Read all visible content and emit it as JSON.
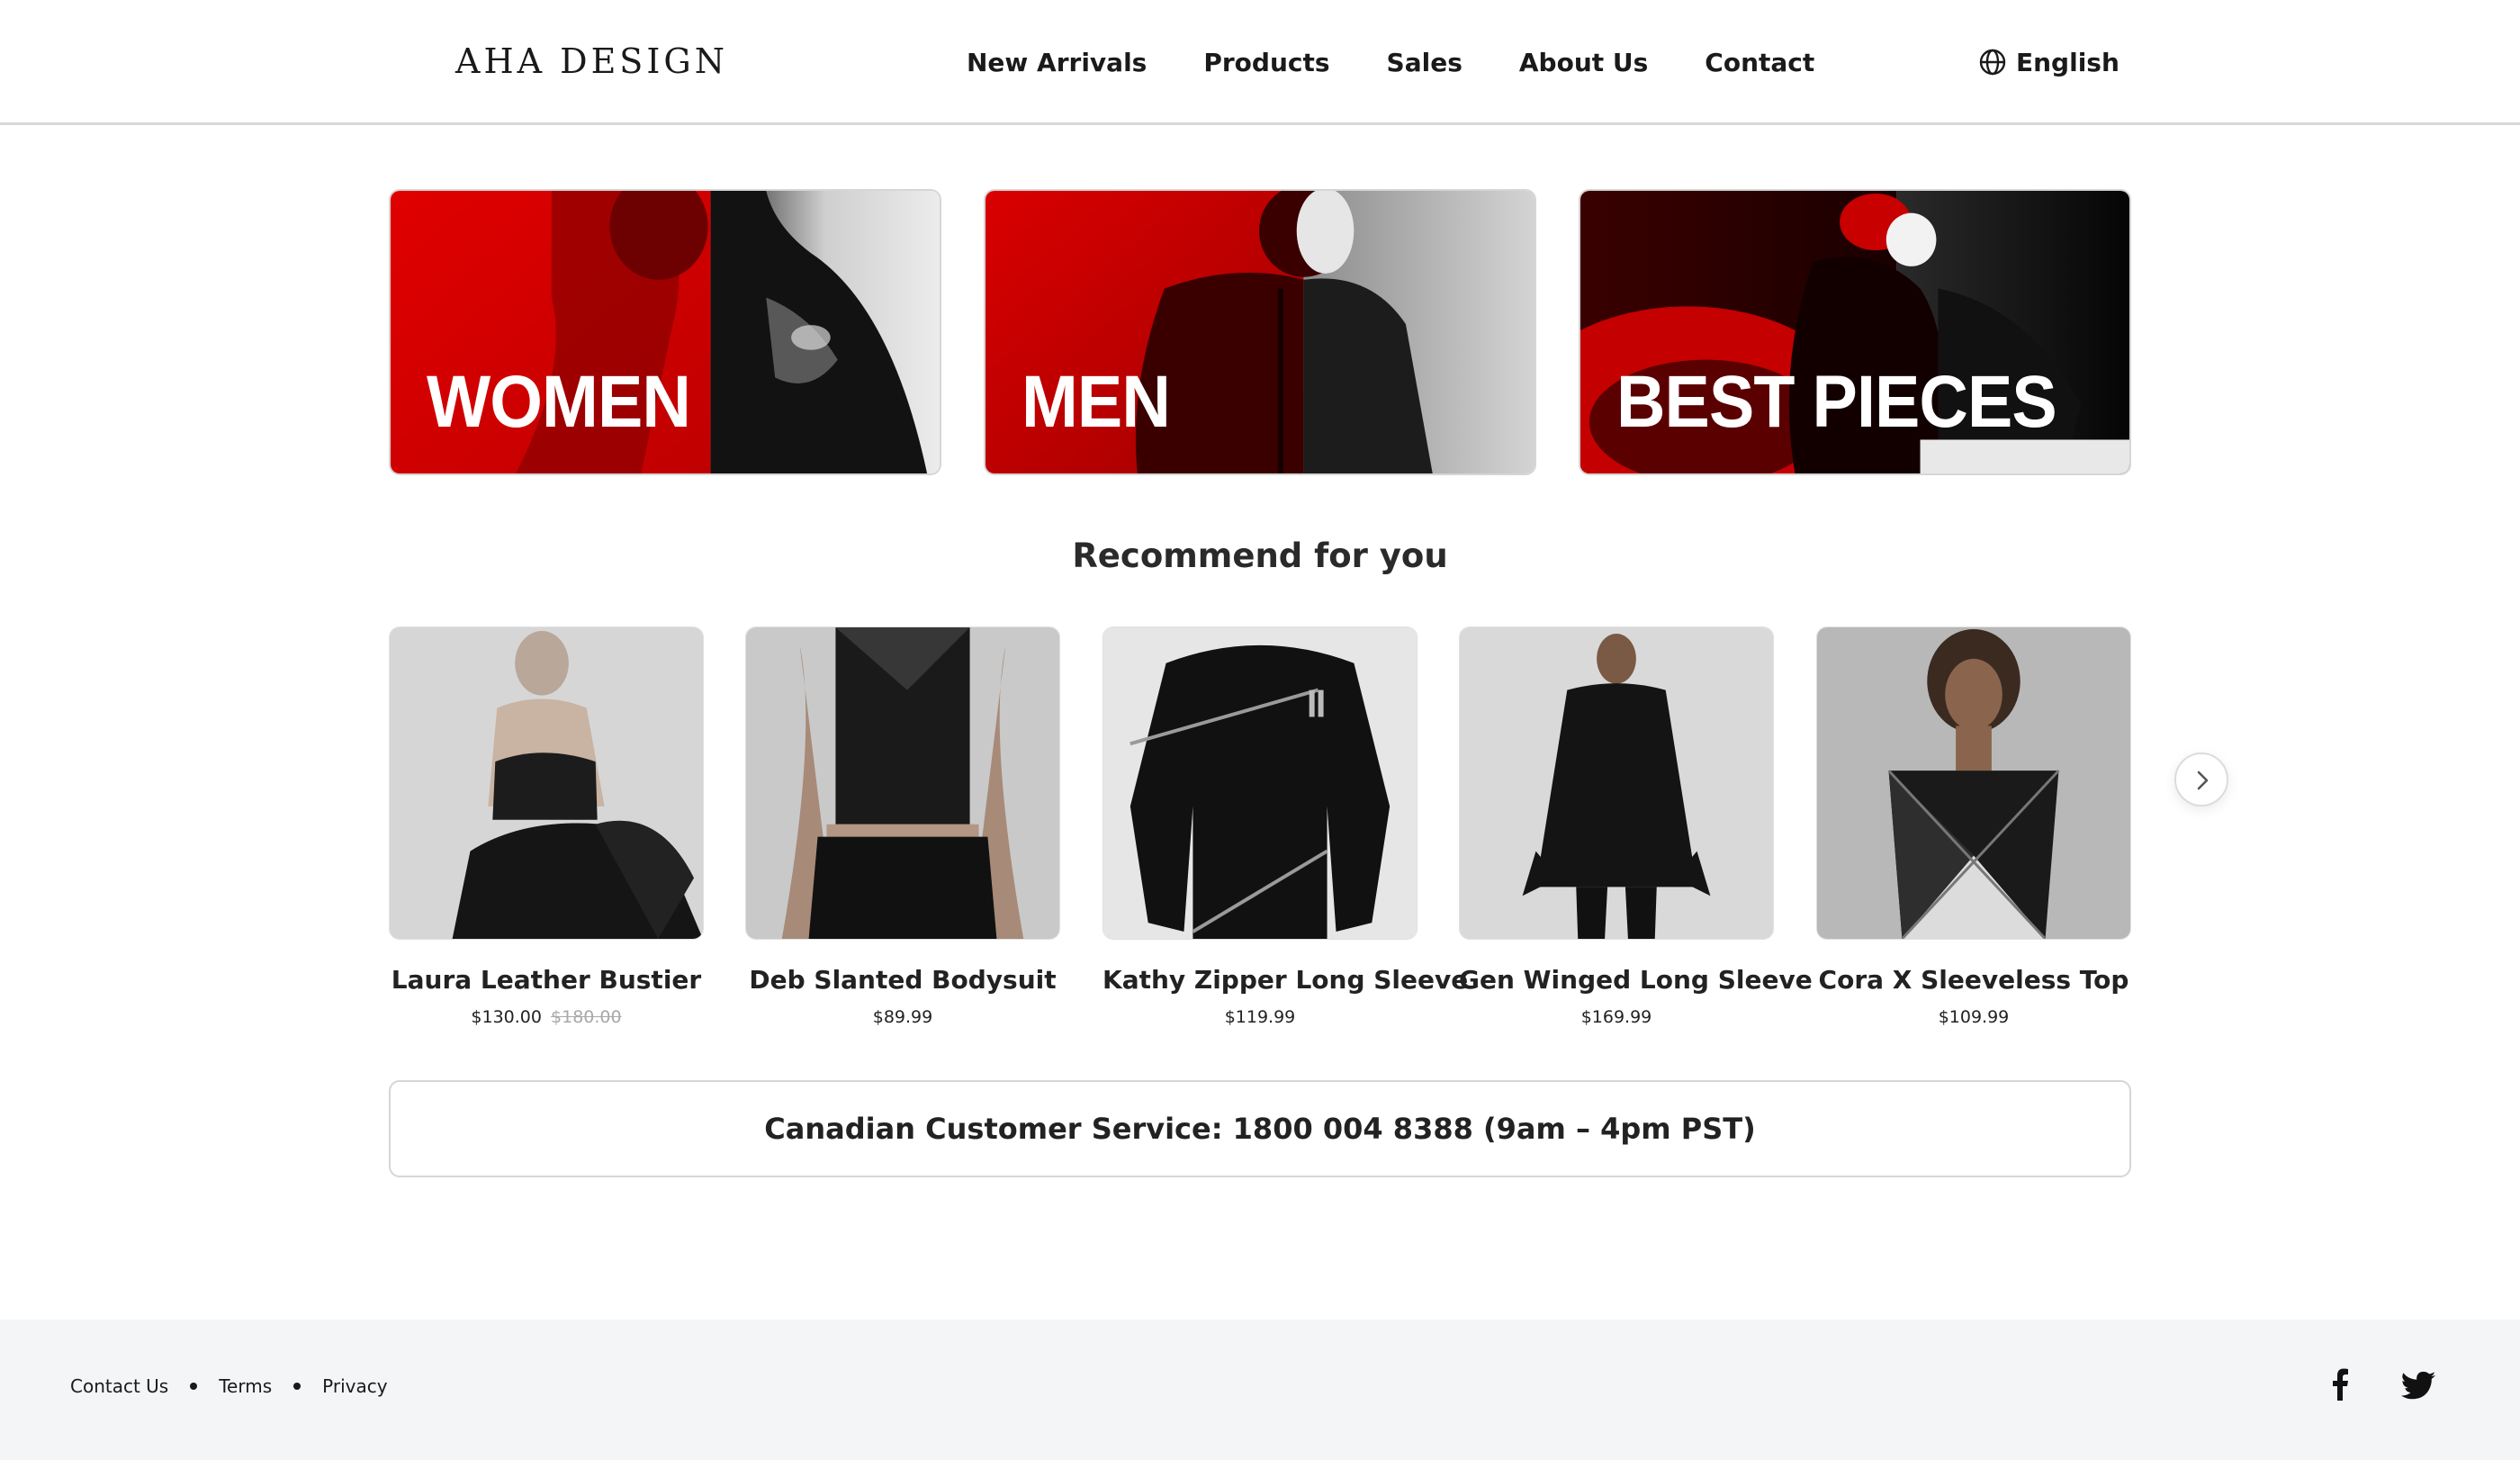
{
  "header": {
    "logo": "AHA DESIGN",
    "nav": [
      "New Arrivals",
      "Products",
      "Sales",
      "About Us",
      "Contact"
    ],
    "language": "English",
    "language_icon": "globe-icon"
  },
  "categories": [
    {
      "label": "WOMEN"
    },
    {
      "label": "MEN"
    },
    {
      "label": "BEST PIECES"
    }
  ],
  "recommend": {
    "title": "Recommend for you",
    "products": [
      {
        "name": "Laura Leather Bustier",
        "price": "$130.00",
        "old_price": "$180.00"
      },
      {
        "name": "Deb Slanted Bodysuit",
        "price": "$89.99"
      },
      {
        "name": "Kathy Zipper Long Sleeve",
        "price": "$119.99"
      },
      {
        "name": "Gen Winged Long Sleeve",
        "price": "$169.99"
      },
      {
        "name": "Cora X Sleeveless Top",
        "price": "$109.99"
      }
    ],
    "next_icon": "chevron-right-icon"
  },
  "service": {
    "text": "Canadian Customer Service: 1800 004 8388 (9am – 4pm PST)"
  },
  "footer": {
    "links": [
      "Contact Us",
      "Terms",
      "Privacy"
    ],
    "social_icons": [
      "facebook-icon",
      "twitter-icon"
    ]
  },
  "colors": {
    "brand_red": "#d10000",
    "dark_red": "#5a0000",
    "text": "#1a1a1a",
    "footer_bg": "#f4f5f7"
  }
}
